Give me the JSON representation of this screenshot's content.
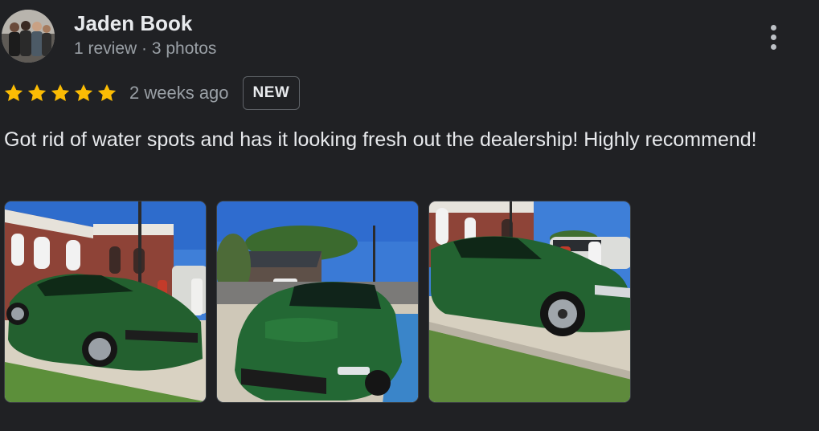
{
  "reviewer": {
    "name": "Jaden Book",
    "meta": "1 review · 3 photos",
    "avatar_icon": "profile-photo-group"
  },
  "menu": {
    "icon": "more-vertical-icon"
  },
  "rating": {
    "stars": 5,
    "max_stars": 5,
    "star_color": "#fbbc04",
    "time_ago": "2 weeks ago",
    "badge": "NEW"
  },
  "review": {
    "text": "Got rid of water spots and has it looking fresh out the dealership! Highly recommend!"
  },
  "photos": {
    "count": 3,
    "items": [
      {
        "subject": "green-mustang-front-left-brick-building"
      },
      {
        "subject": "green-mustang-front-view-street"
      },
      {
        "subject": "green-mustang-side-view-brick-building"
      }
    ]
  },
  "colors": {
    "background": "#202124",
    "primary_text": "#e8eaed",
    "secondary_text": "#9aa0a6"
  }
}
